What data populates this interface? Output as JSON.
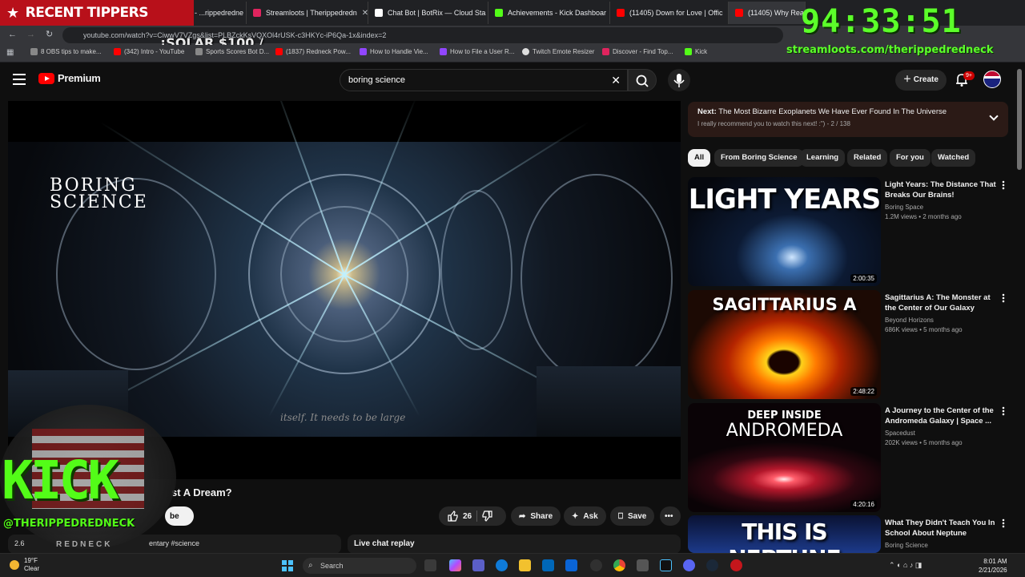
{
  "overlay": {
    "recent_tippers": "RECENT TIPPERS",
    "solar": "¡SOLAR $100 /",
    "timer": "94:33:51",
    "stream_url": "streamloots.com/therippedredneck",
    "kick_logo": "KICK",
    "kick_handle": "@THERIPPEDREDNECK",
    "kick_sub": "REDNECK"
  },
  "browser": {
    "tabs": [
      {
        "label": "StreamElements - ...rippedredne",
        "color": "#7a4cff"
      },
      {
        "label": "Streamloots | Therippedredn",
        "color": "#e0245e"
      },
      {
        "label": "Chat Bot | BotRix — Cloud Sta",
        "color": "#ffffff"
      },
      {
        "label": "Achievements - Kick Dashboar",
        "color": "#53fc18"
      },
      {
        "label": "(11405) Down for Love | Offic",
        "color": "#ff0000"
      },
      {
        "label": "(11405) Why Reachi",
        "color": "#ff0000"
      }
    ],
    "url": "youtube.com/watch?v=CiwwV7VZgs&list=PLBZckKsVQXOl4rUSK-c3HKYc-iP6Qa-1x&index=2",
    "bookmarks": [
      {
        "label": "8 OBS tips to make...",
        "color": "#888888"
      },
      {
        "label": "(342) Intro - YouTube",
        "color": "#ff0000"
      },
      {
        "label": "Sports Scores Bot D...",
        "color": "#888888"
      },
      {
        "label": "(1837) Redneck Pow...",
        "color": "#ff0000"
      },
      {
        "label": "How to Handle Vie...",
        "color": "#9146ff"
      },
      {
        "label": "How to File a User R...",
        "color": "#9146ff"
      },
      {
        "label": "Twitch Emote Resizer",
        "color": "#dddddd"
      },
      {
        "label": "Discover - Find Top...",
        "color": "#e0245e"
      },
      {
        "label": "Kick",
        "color": "#53fc18"
      }
    ]
  },
  "yt": {
    "brand": "Premium",
    "search_value": "boring science",
    "create_label": "Create",
    "notif_badge": "9+",
    "video": {
      "channel_logo_1": "BORING",
      "channel_logo_2": "SCIENCE",
      "subtitle": "itself. It needs to be large",
      "title_visible": "st A Dream?",
      "subscribe_fragment": "be",
      "likes": "26",
      "share_label": "Share",
      "ask_label": "Ask",
      "save_label": "Save",
      "views_fragment": "2.6",
      "tags_fragment": "entary #science",
      "live_chat_label": "Live chat replay"
    },
    "next": {
      "prefix": "Next:",
      "title": "The Most Bizarre Exoplanets We Have Ever Found In The Universe",
      "sub": "I really recommend you to watch this next! :\") - 2 / 138"
    },
    "chips": [
      "All",
      "From Boring Science",
      "Learning",
      "Related",
      "For you",
      "Watched"
    ],
    "recs": [
      {
        "thumb_text": "LIGHT YEARS",
        "duration": "2:00:35",
        "title": "Light Years: The Distance That Breaks Our Brains!",
        "channel": "Boring Space",
        "views": "1.2M views • 2 months ago"
      },
      {
        "thumb_text": "SAGITTARIUS A",
        "duration": "2:48:22",
        "title": "Sagittarius A: The Monster at the Center of Our Galaxy",
        "channel": "Beyond Horizons",
        "views": "686K views • 5 months ago"
      },
      {
        "thumb_text_1": "DEEP INSIDE",
        "thumb_text_2": "ANDROMEDA",
        "duration": "4:20:16",
        "title": "A Journey to the Center of the Andromeda Galaxy | Space ...",
        "channel": "Spacedust",
        "views": "202K views • 5 months ago"
      },
      {
        "thumb_text": "THIS IS NEPTUNE",
        "title": "What They Didn't Teach You In School About Neptune",
        "channel": "Boring Science"
      }
    ]
  },
  "taskbar": {
    "temp": "19°F",
    "condition": "Clear",
    "search_label": "Search",
    "time": "8:01 AM",
    "date": "2/21/2026"
  }
}
